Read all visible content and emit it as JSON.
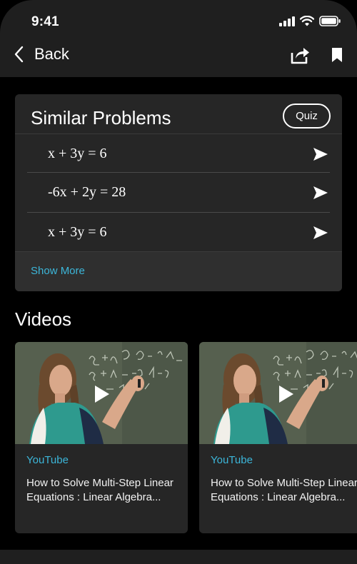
{
  "status_bar": {
    "time": "9:41"
  },
  "nav": {
    "back_label": "Back"
  },
  "similar_problems": {
    "title": "Similar Problems",
    "quiz_label": "Quiz",
    "problems": [
      {
        "equation": "x + 3y = 6"
      },
      {
        "equation": "-6x + 2y = 28"
      },
      {
        "equation": "x + 3y = 6"
      }
    ],
    "show_more_label": "Show More"
  },
  "videos": {
    "title": "Videos",
    "items": [
      {
        "source": "YouTube",
        "title": "How to Solve Multi-Step Linear Equations : Linear Algebra..."
      },
      {
        "source": "YouTube",
        "title": "How to Solve Multi-Step Linear Equations : Linear Algebra..."
      }
    ]
  },
  "colors": {
    "accent": "#3cb6d9",
    "card": "#262626",
    "header": "#1f1f1f",
    "background": "#000000"
  }
}
